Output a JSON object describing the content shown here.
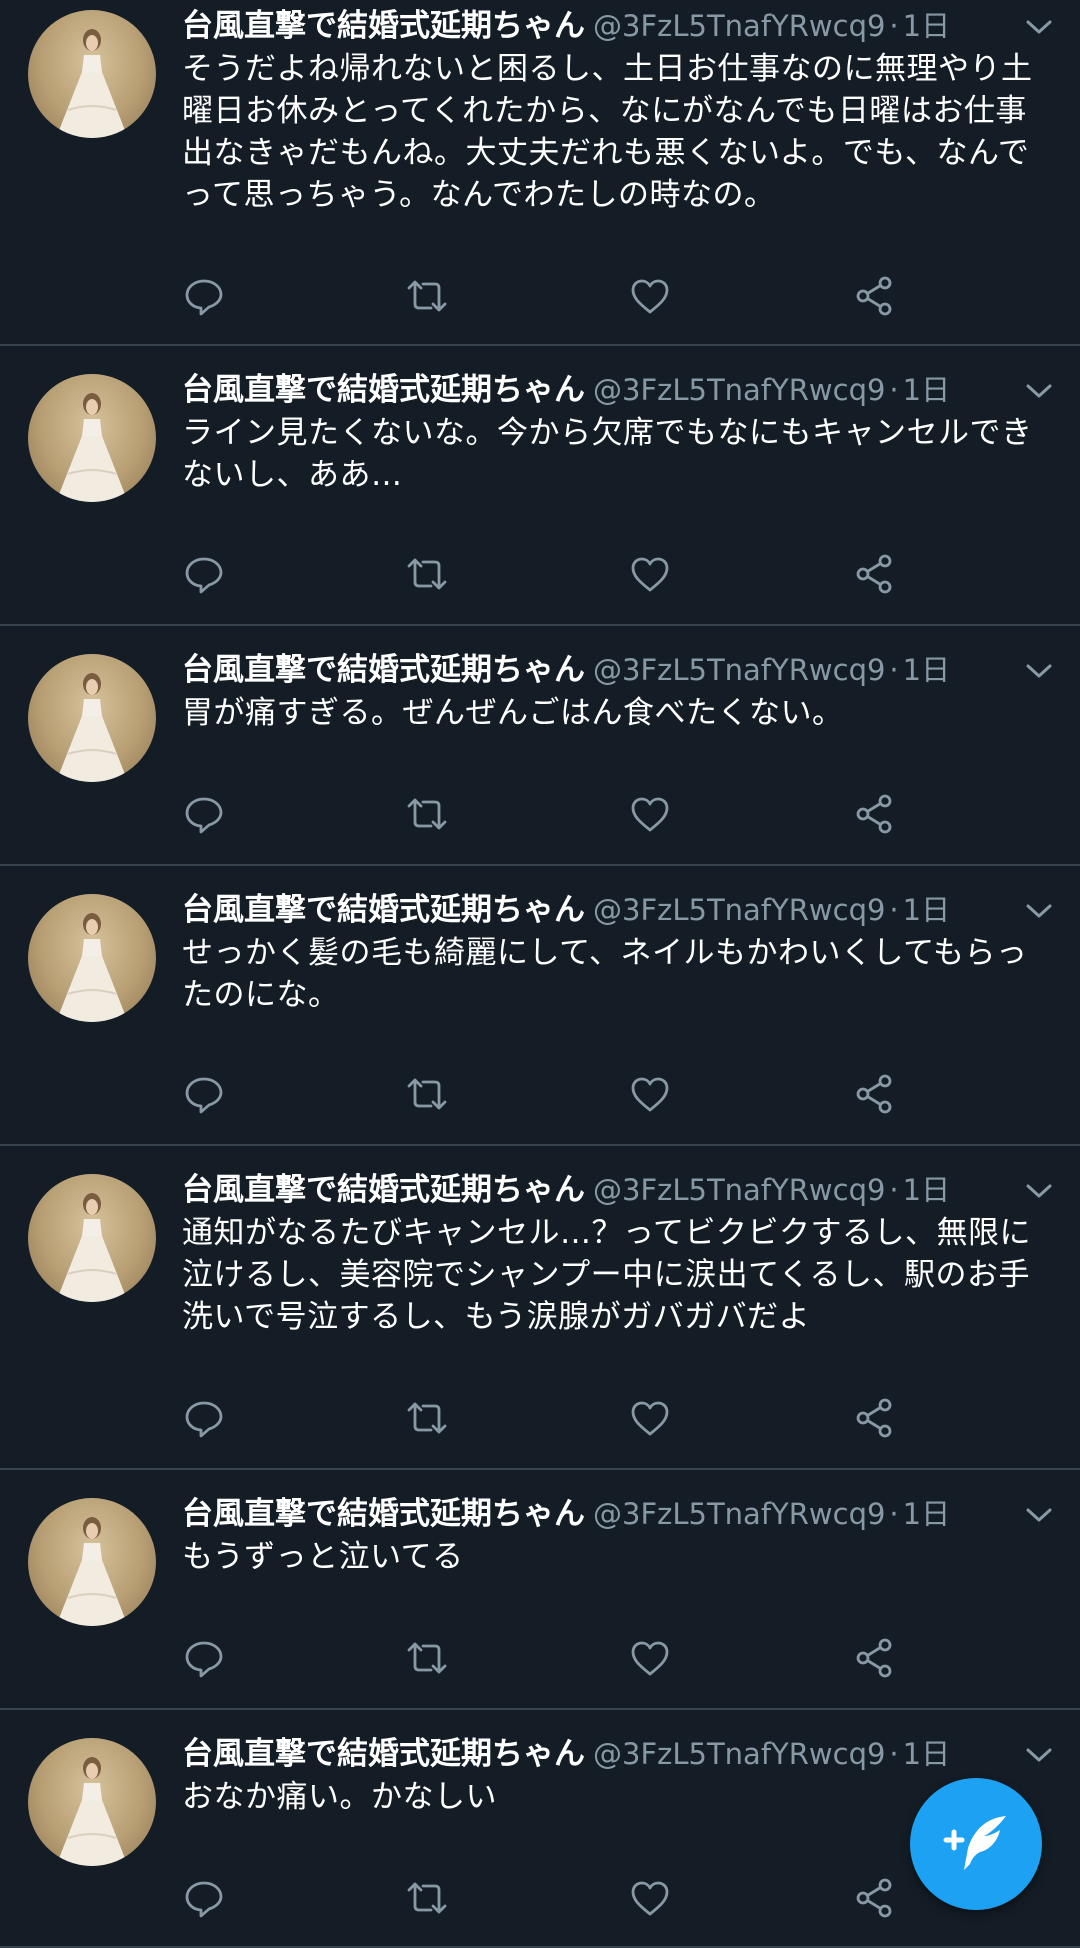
{
  "colors": {
    "background": "#141d26",
    "divider": "#38444d",
    "secondary_text": "#8899a6",
    "accent": "#1da1f2"
  },
  "tweets": [
    {
      "name": "台風直撃で結婚式延期ちゃん",
      "handle": "@3FzL5TnafYRwcq9",
      "separator": "·",
      "time": "1日",
      "text": "そうだよね帰れないと困るし、土日お仕事なのに無理やり土曜日お休みとってくれたから、なにがなんでも日曜はお仕事出なきゃだもんね。大丈夫だれも悪くないよ。でも、なんでって思っちゃう。なんでわたしの時なの。"
    },
    {
      "name": "台風直撃で結婚式延期ちゃん",
      "handle": "@3FzL5TnafYRwcq9",
      "separator": "·",
      "time": "1日",
      "text": "ライン見たくないな。今から欠席でもなにもキャンセルできないし、ああ…"
    },
    {
      "name": "台風直撃で結婚式延期ちゃん",
      "handle": "@3FzL5TnafYRwcq9",
      "separator": "·",
      "time": "1日",
      "text": "胃が痛すぎる。ぜんぜんごはん食べたくない。"
    },
    {
      "name": "台風直撃で結婚式延期ちゃん",
      "handle": "@3FzL5TnafYRwcq9",
      "separator": "·",
      "time": "1日",
      "text": "せっかく髪の毛も綺麗にして、ネイルもかわいくしてもらったのにな。"
    },
    {
      "name": "台風直撃で結婚式延期ちゃん",
      "handle": "@3FzL5TnafYRwcq9",
      "separator": "·",
      "time": "1日",
      "text": "通知がなるたびキャンセル…？ってビクビクするし、無限に泣けるし、美容院でシャンプー中に涙出てくるし、駅のお手洗いで号泣するし、もう涙腺がガバガバだよ"
    },
    {
      "name": "台風直撃で結婚式延期ちゃん",
      "handle": "@3FzL5TnafYRwcq9",
      "separator": "·",
      "time": "1日",
      "text": "もうずっと泣いてる"
    },
    {
      "name": "台風直撃で結婚式延期ちゃん",
      "handle": "@3FzL5TnafYRwcq9",
      "separator": "·",
      "time": "1日",
      "text": "おなか痛い。かなしい"
    }
  ],
  "icons": {
    "reply": "reply-icon",
    "retweet": "retweet-icon",
    "like": "heart-icon",
    "share": "share-icon",
    "more": "chevron-down-icon",
    "compose": "compose-tweet-icon"
  }
}
